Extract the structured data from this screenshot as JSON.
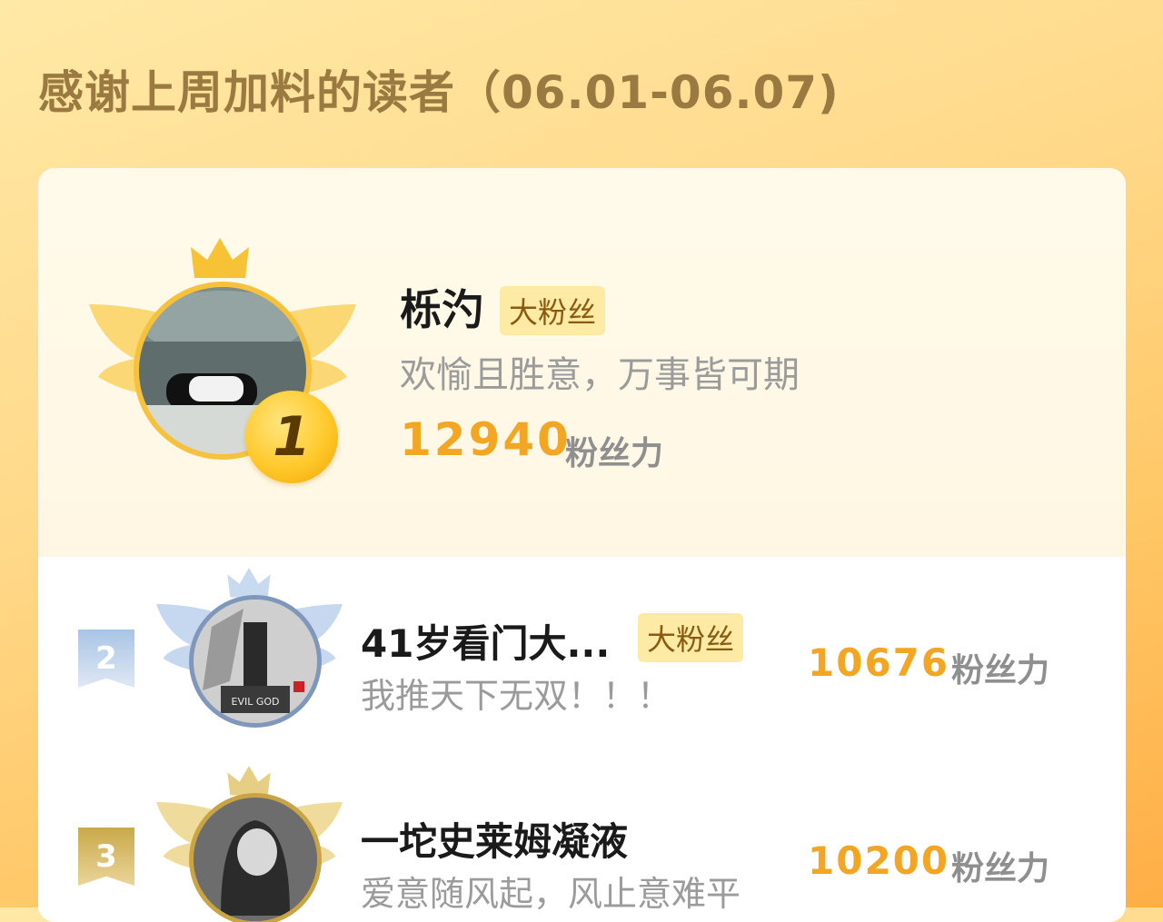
{
  "page": {
    "title": "感谢上周加料的读者（06.01-06.07)"
  },
  "top_reader": {
    "rank": "1",
    "name": "栎汋",
    "badge": "大粉丝",
    "motto": "欢愉且胜意，万事皆可期",
    "score": "12940",
    "score_unit": "粉丝力"
  },
  "readers": [
    {
      "rank": "2",
      "name": "41岁看门大...",
      "badge": "大粉丝",
      "motto": "我推天下无双！！！",
      "score": "10676",
      "score_unit": "粉丝力",
      "avatar_caption": "EVIL GOD"
    },
    {
      "rank": "3",
      "name": "一坨史莱姆凝液",
      "badge": "",
      "motto": "爱意随风起，风止意难平",
      "score": "10200",
      "score_unit": "粉丝力"
    }
  ],
  "colors": {
    "gold": "#f3a623",
    "silver_rank": "#9fb8d8",
    "bronze_rank": "#d1b25a",
    "badge_bg": "#fdeaa4"
  }
}
